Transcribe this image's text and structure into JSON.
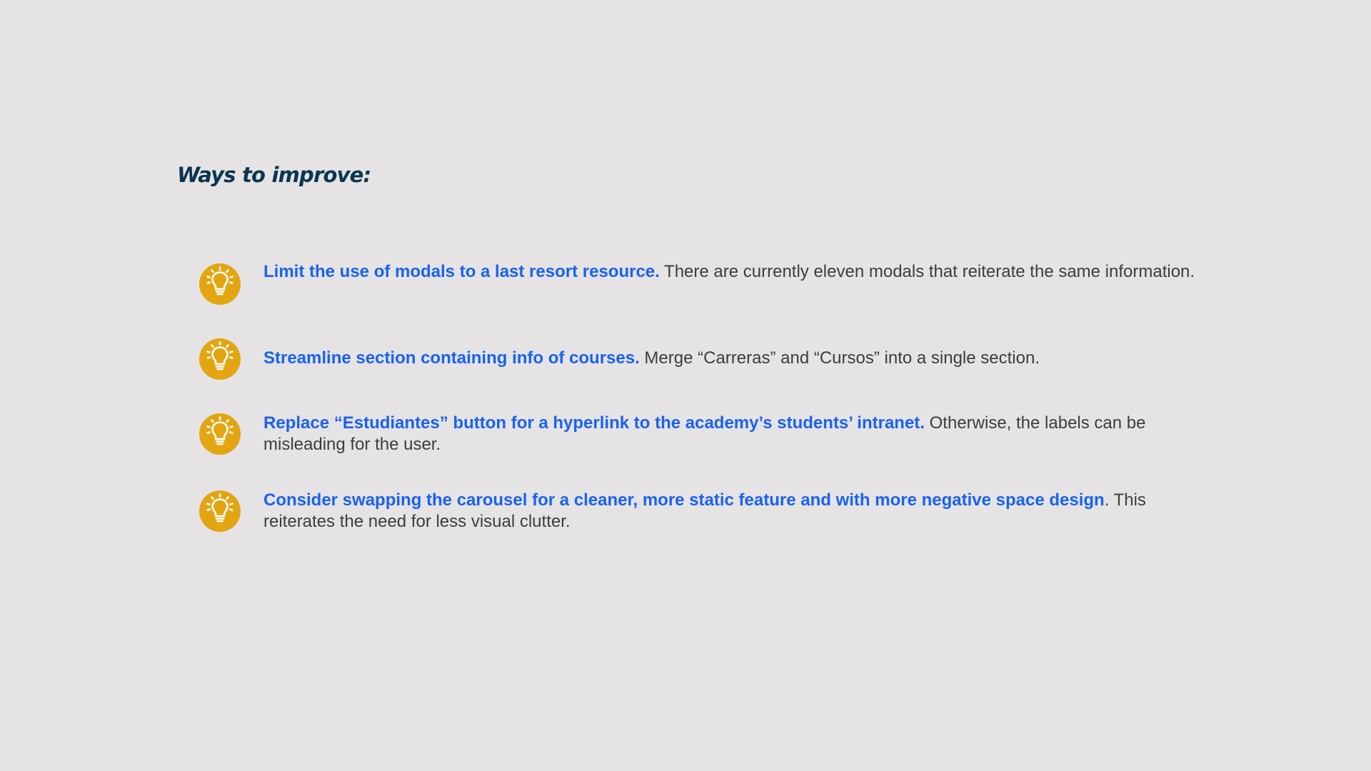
{
  "title": "Ways to improve:",
  "icon": {
    "name": "lightbulb-icon",
    "background": "#e3a612",
    "stroke": "#ffffff"
  },
  "colors": {
    "background": "#e5e3e4",
    "title": "#0b3550",
    "lead": "#1a62f0",
    "body": "#3d3d3d"
  },
  "tips": [
    {
      "lead": "Limit the use of modals to a last resort resource.",
      "body": " There are currently eleven modals that reiterate the same information."
    },
    {
      "lead": "Streamline section containing info of courses.",
      "body": " Merge “Carreras” and “Cursos” into a single section."
    },
    {
      "lead": "Replace “Estudiantes” button for a hyperlink to  the academy’s students’ intranet.",
      "body": " Otherwise, the labels can be misleading for the user."
    },
    {
      "lead": "Consider swapping the carousel for a cleaner, more static feature and with more negative space design",
      "body": ". This reiterates the need for less visual clutter."
    }
  ]
}
